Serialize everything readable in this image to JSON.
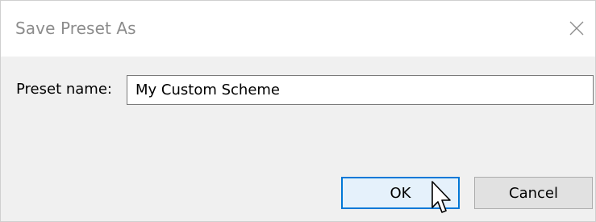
{
  "dialog": {
    "title": "Save Preset As",
    "close_icon": "close-icon"
  },
  "form": {
    "label": "Preset name:",
    "value": "My Custom Scheme"
  },
  "buttons": {
    "ok_label": "OK",
    "cancel_label": "Cancel"
  },
  "colors": {
    "accent": "#0078d7",
    "default_button_bg": "#e5f1fb",
    "button_bg": "#e1e1e1",
    "dialog_bg": "#f0f0f0"
  },
  "pointer_icon": "mouse-pointer-icon"
}
